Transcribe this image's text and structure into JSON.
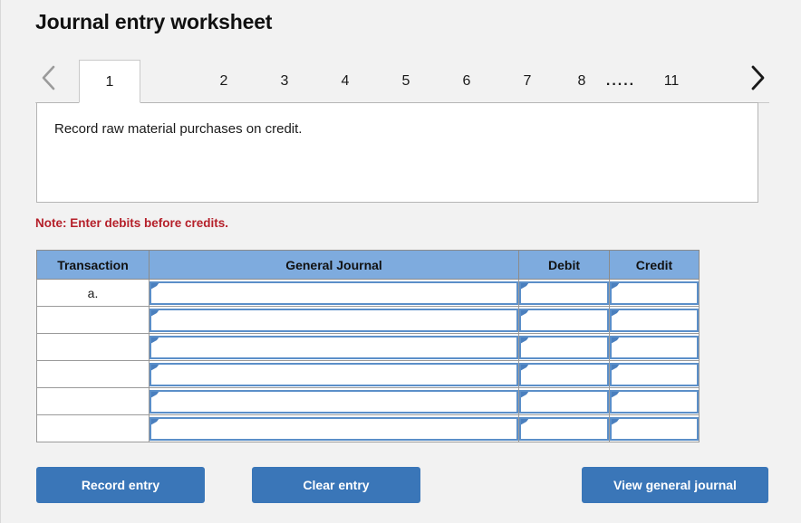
{
  "header": {
    "title": "Journal entry worksheet"
  },
  "tabs": {
    "prev_icon": "chevron-left-icon",
    "next_icon": "chevron-right-icon",
    "active_index": 0,
    "items": [
      {
        "label": "1",
        "active": true,
        "type": "tab"
      },
      {
        "label": "2",
        "active": false,
        "type": "tab"
      },
      {
        "label": "3",
        "active": false,
        "type": "tab"
      },
      {
        "label": "4",
        "active": false,
        "type": "tab"
      },
      {
        "label": "5",
        "active": false,
        "type": "tab"
      },
      {
        "label": "6",
        "active": false,
        "type": "tab"
      },
      {
        "label": "7",
        "active": false,
        "type": "tab"
      },
      {
        "label": "8",
        "active": false,
        "type": "tab"
      },
      {
        "label": ".....",
        "active": false,
        "type": "ellipsis"
      },
      {
        "label": "11",
        "active": false,
        "type": "tab"
      }
    ]
  },
  "instruction": {
    "text": "Record raw material purchases on credit."
  },
  "note": {
    "text": "Note: Enter debits before credits."
  },
  "table": {
    "columns": [
      "Transaction",
      "General Journal",
      "Debit",
      "Credit"
    ],
    "rows": [
      {
        "transaction": "a.",
        "general_journal": "",
        "debit": "",
        "credit": ""
      },
      {
        "transaction": "",
        "general_journal": "",
        "debit": "",
        "credit": ""
      },
      {
        "transaction": "",
        "general_journal": "",
        "debit": "",
        "credit": ""
      },
      {
        "transaction": "",
        "general_journal": "",
        "debit": "",
        "credit": ""
      },
      {
        "transaction": "",
        "general_journal": "",
        "debit": "",
        "credit": ""
      },
      {
        "transaction": "",
        "general_journal": "",
        "debit": "",
        "credit": ""
      }
    ]
  },
  "buttons": {
    "record": "Record entry",
    "clear": "Clear entry",
    "view": "View general journal"
  },
  "colors": {
    "page_background": "#f2f2f2",
    "table_header_blue": "#7eabde",
    "button_blue": "#3a76b8",
    "note_red": "#b5202a",
    "cell_border_blue": "#5b8fc9"
  }
}
